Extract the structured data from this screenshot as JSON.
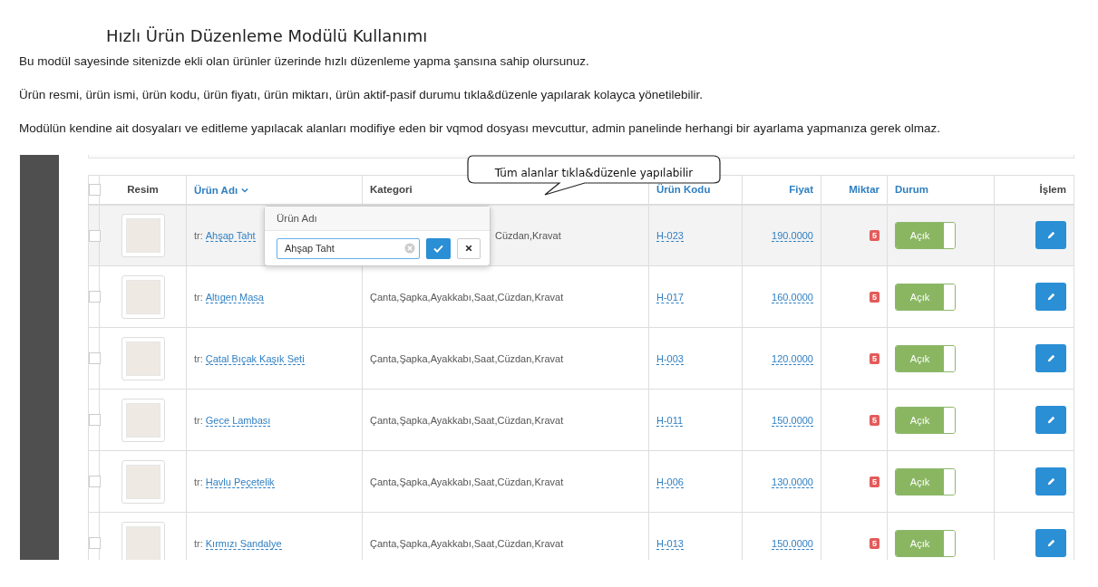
{
  "title": "Hızlı Ürün Düzenleme Modülü Kullanımı",
  "paragraphs": [
    "Bu modül sayesinde sitenizde ekli olan ürünler üzerinde hızlı düzenleme yapma şansına sahip olursunuz.",
    "Ürün resmi, ürün ismi, ürün kodu, ürün fiyatı, ürün miktarı, ürün aktif-pasif durumu tıkla&düzenle yapılarak kolayca yönetilebilir.",
    "Modülün kendine ait dosyaları ve editleme yapılacak alanları modifiye eden bir vqmod dosyası mevcuttur, admin panelinde herhangi bir ayarlama yapmanıza gerek olmaz."
  ],
  "callout": "Tüm alanlar tıkla&düzenle yapılabilir",
  "table": {
    "select_all": {
      "checked": false
    },
    "columns": [
      {
        "label": "Resim",
        "sortable": false,
        "sorted": false
      },
      {
        "label": "Ürün Adı",
        "sortable": true,
        "sorted": true
      },
      {
        "label": "Kategori",
        "sortable": false,
        "sorted": false
      },
      {
        "label": "Ürün Kodu",
        "sortable": true,
        "sorted": false
      },
      {
        "label": "Fiyat",
        "sortable": true,
        "sorted": false
      },
      {
        "label": "Miktar",
        "sortable": true,
        "sorted": false
      },
      {
        "label": "Durum",
        "sortable": true,
        "sorted": false
      },
      {
        "label": "İşlem",
        "sortable": false,
        "sorted": false
      }
    ],
    "rows": [
      {
        "checked": false,
        "highlighted": true,
        "lang": "tr:",
        "name": "Ahşap Taht",
        "category": "Cüzdan,Kravat",
        "code": "H-023",
        "price": "190.0000",
        "quantity": "5",
        "status": {
          "label": "Açık",
          "on": true
        },
        "editor": {
          "title": "Ürün Adı",
          "value": "Ahşap Taht"
        }
      },
      {
        "checked": false,
        "highlighted": false,
        "lang": "tr:",
        "name": "Altıgen Masa",
        "category": "Çanta,Şapka,Ayakkabı,Saat,Cüzdan,Kravat",
        "code": "H-017",
        "price": "160.0000",
        "quantity": "5",
        "status": {
          "label": "Açık",
          "on": true
        }
      },
      {
        "checked": false,
        "highlighted": false,
        "lang": "tr:",
        "name": "Çatal Bıçak Kaşık Seti",
        "category": "Çanta,Şapka,Ayakkabı,Saat,Cüzdan,Kravat",
        "code": "H-003",
        "price": "120.0000",
        "quantity": "5",
        "status": {
          "label": "Açık",
          "on": true
        }
      },
      {
        "checked": false,
        "highlighted": false,
        "lang": "tr:",
        "name": "Gece Lambası",
        "category": "Çanta,Şapka,Ayakkabı,Saat,Cüzdan,Kravat",
        "code": "H-011",
        "price": "150.0000",
        "quantity": "5",
        "status": {
          "label": "Açık",
          "on": true
        }
      },
      {
        "checked": false,
        "highlighted": false,
        "lang": "tr:",
        "name": "Havlu Peçetelik",
        "category": "Çanta,Şapka,Ayakkabı,Saat,Cüzdan,Kravat",
        "code": "H-006",
        "price": "130.0000",
        "quantity": "5",
        "status": {
          "label": "Açık",
          "on": true
        }
      },
      {
        "checked": false,
        "highlighted": false,
        "lang": "tr:",
        "name": "Kırmızı Sandalye",
        "category": "Çanta,Şapka,Ayakkabı,Saat,Cüzdan,Kravat",
        "code": "H-013",
        "price": "150.0000",
        "quantity": "5",
        "status": {
          "label": "Açık",
          "on": true
        }
      }
    ]
  }
}
